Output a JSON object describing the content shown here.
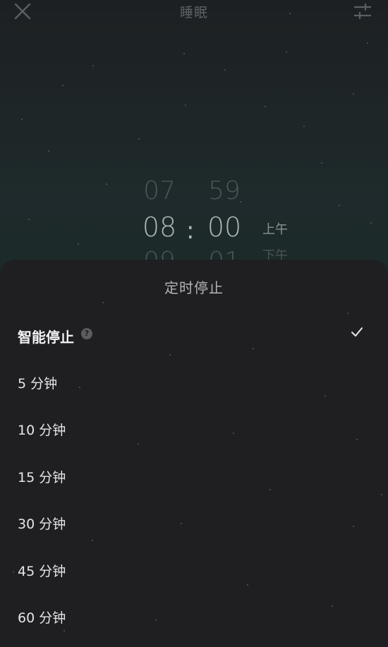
{
  "header": {
    "title": "睡眠",
    "close_icon": "close-icon",
    "settings_icon": "sliders-icon"
  },
  "picker": {
    "hours": {
      "prev": "07",
      "current": "08",
      "next": "09"
    },
    "minutes": {
      "prev": "59",
      "current": "00",
      "next": "01"
    },
    "separator": ":",
    "period": {
      "current": "上午",
      "next": "下午"
    }
  },
  "sheet": {
    "title": "定时停止",
    "selected_icon": "check-icon",
    "options": [
      {
        "label": "智能停止",
        "has_help": true,
        "selected": true
      },
      {
        "label": "5 分钟"
      },
      {
        "label": "10 分钟"
      },
      {
        "label": "15 分钟"
      },
      {
        "label": "30 分钟"
      },
      {
        "label": "45 分钟"
      },
      {
        "label": "60 分钟"
      }
    ],
    "help_glyph": "?"
  },
  "colors": {
    "sheet_bg": "#1f1f22",
    "text_primary": "#e6e6e8",
    "picker_active": "#aeb4b7",
    "picker_faded": "#4c5558"
  }
}
